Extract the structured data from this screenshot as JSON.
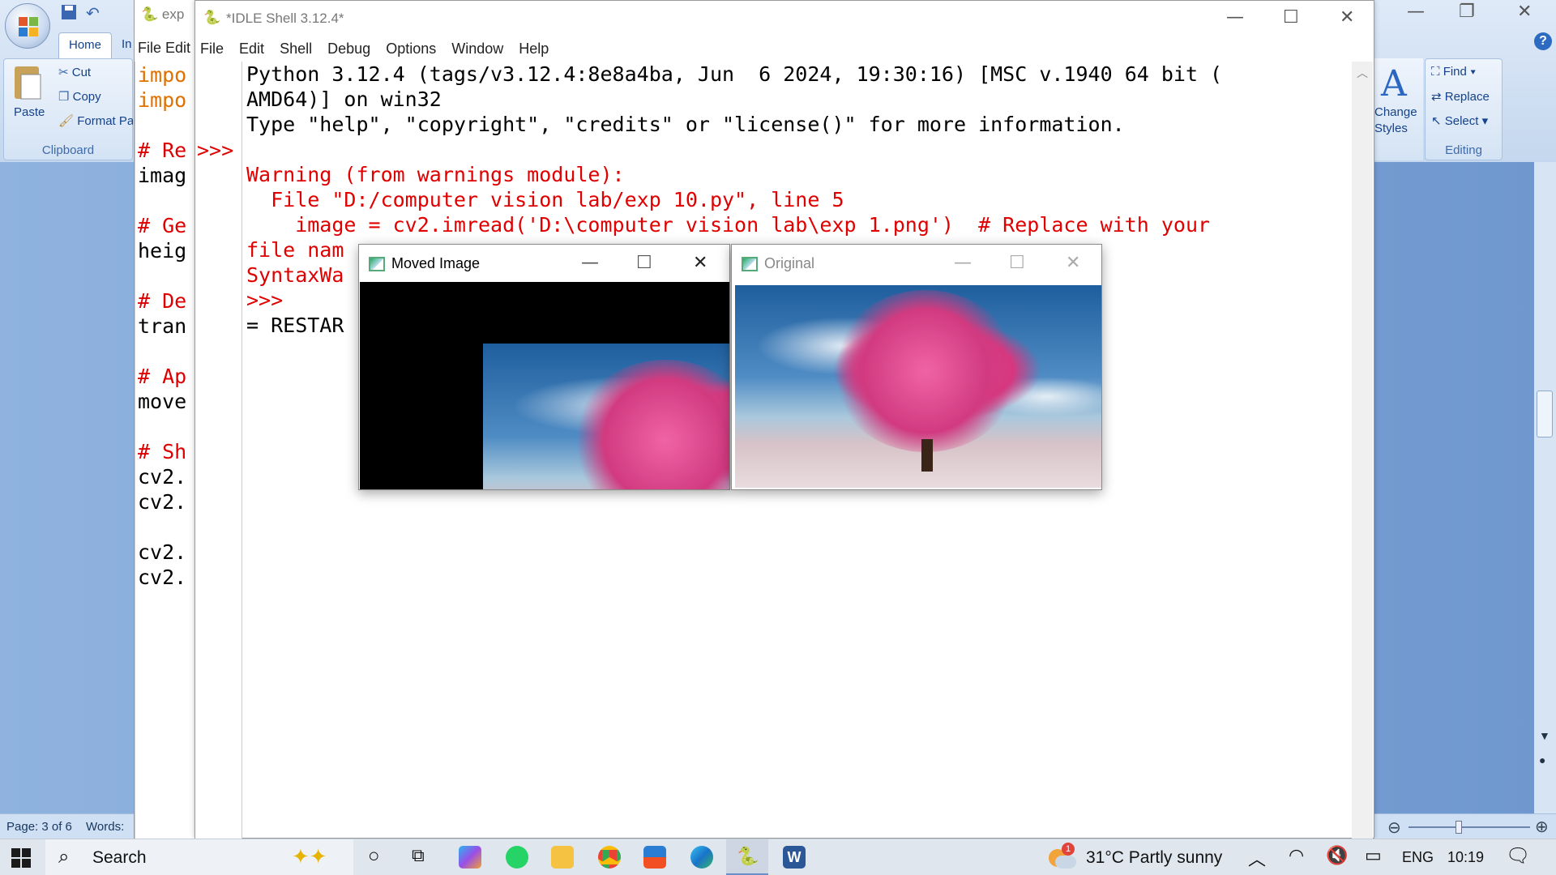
{
  "word": {
    "ribbon": {
      "tab_home": "Home",
      "tab_next": "In",
      "paste": "Paste",
      "cut": "Cut",
      "copy": "Copy",
      "format_painter": "Format Pa",
      "clipboard_group": "Clipboard",
      "change_styles_1": "Change",
      "change_styles_2": "Styles",
      "find": "Find",
      "replace": "Replace",
      "select": "Select",
      "editing_group": "Editing"
    },
    "status": {
      "page": "Page: 3 of 6",
      "words": "Words:"
    }
  },
  "editor": {
    "tab_title": "exp",
    "menu": [
      "File",
      "Edit"
    ],
    "lines": [
      {
        "text": "impo",
        "color": "#e07000"
      },
      {
        "text": "impo",
        "color": "#e07000"
      },
      {
        "text": "",
        "color": "#000"
      },
      {
        "text": "# Re",
        "color": "#dd0000"
      },
      {
        "text": "imag",
        "color": "#000"
      },
      {
        "text": "",
        "color": "#000"
      },
      {
        "text": "# Ge",
        "color": "#dd0000"
      },
      {
        "text": "heig",
        "color": "#000"
      },
      {
        "text": "",
        "color": "#000"
      },
      {
        "text": "# De",
        "color": "#dd0000"
      },
      {
        "text": "tran",
        "color": "#000"
      },
      {
        "text": "",
        "color": "#000"
      },
      {
        "text": "# Ap",
        "color": "#dd0000"
      },
      {
        "text": "move",
        "color": "#000"
      },
      {
        "text": "",
        "color": "#000"
      },
      {
        "text": "# Sh",
        "color": "#dd0000"
      },
      {
        "text": "cv2.",
        "color": "#000"
      },
      {
        "text": "cv2.",
        "color": "#000"
      },
      {
        "text": "",
        "color": "#000"
      },
      {
        "text": "cv2.",
        "color": "#000"
      },
      {
        "text": "cv2.",
        "color": "#000"
      }
    ]
  },
  "idle": {
    "title": "*IDLE Shell 3.12.4*",
    "menu": [
      "File",
      "Edit",
      "Shell",
      "Debug",
      "Options",
      "Window",
      "Help"
    ],
    "prompt": ">>>",
    "lines": [
      {
        "text": "Python 3.12.4 (tags/v3.12.4:8e8a4ba, Jun  6 2024, 19:30:16) [MSC v.1940 64 bit (",
        "red": false
      },
      {
        "text": "AMD64)] on win32",
        "red": false
      },
      {
        "text": "Type \"help\", \"copyright\", \"credits\" or \"license()\" for more information.",
        "red": false
      },
      {
        "text": "",
        "red": false
      },
      {
        "text": "Warning (from warnings module):",
        "red": true
      },
      {
        "text": "  File \"D:/computer vision lab/exp 10.py\", line 5",
        "red": true
      },
      {
        "text": "    image = cv2.imread('D:\\computer vision lab\\exp 1.png')  # Replace with your",
        "red": true
      },
      {
        "text": "file nam",
        "red": true
      },
      {
        "text": "SyntaxWa",
        "red": true
      },
      {
        "text": ">>>",
        "red": true
      },
      {
        "text": "= RESTAR",
        "red": false
      }
    ]
  },
  "cv_moved": {
    "title": "Moved Image"
  },
  "cv_original": {
    "title": "Original"
  },
  "taskbar": {
    "search": "Search",
    "weather": "31°C  Partly sunny",
    "weather_badge": "1",
    "lang": "ENG",
    "time": "10:19"
  }
}
